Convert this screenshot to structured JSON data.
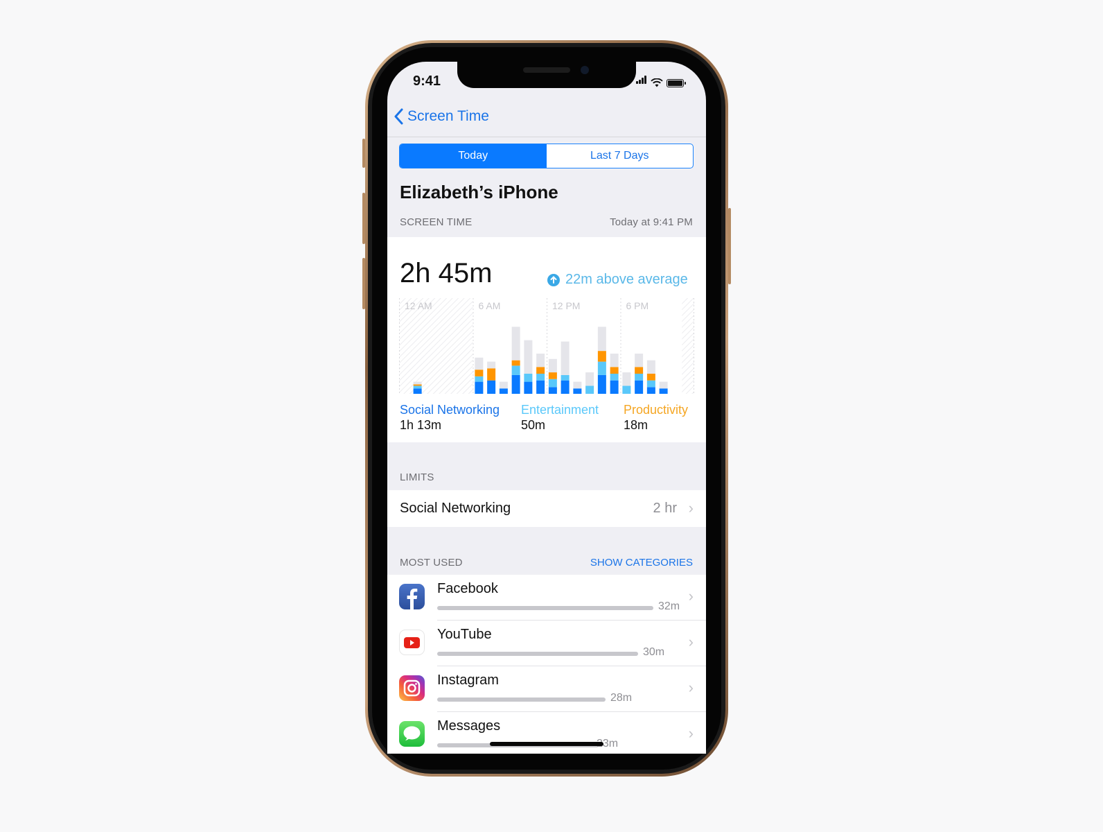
{
  "status_bar": {
    "time": "9:41",
    "icons": [
      "signal-icon",
      "wifi-icon",
      "battery-icon"
    ]
  },
  "nav": {
    "back_label": "Screen Time",
    "back_icon": "chevron-left-icon"
  },
  "segmented": {
    "options": [
      "Today",
      "Last 7 Days"
    ],
    "selected": "Today"
  },
  "device_title": "Elizabeth’s iPhone",
  "screen_time_section": {
    "header": "SCREEN TIME",
    "timestamp": "Today at 9:41 PM",
    "total": "2h 45m",
    "comparison": "22m above average",
    "comparison_icon": "arrow-up-circle-icon"
  },
  "colors": {
    "social": "#0a7aff",
    "entertainment": "#5ac8fa",
    "productivity": "#ff9500",
    "other": "#e5e5ea",
    "accent": "#1a74e8"
  },
  "chart_data": {
    "type": "bar",
    "stacked": true,
    "title": "",
    "xlabel": "",
    "ylabel": "",
    "tick_labels": [
      "12 AM",
      "6 AM",
      "12 PM",
      "6 PM"
    ],
    "categories": [
      "0",
      "1",
      "2",
      "3",
      "4",
      "5",
      "6",
      "7",
      "8",
      "9",
      "10",
      "11",
      "12",
      "13",
      "14",
      "15",
      "16",
      "17",
      "18",
      "19",
      "20",
      "21",
      "22",
      "23"
    ],
    "series": [
      {
        "name": "Social Networking",
        "values": [
          0,
          4,
          0,
          0,
          0,
          0,
          9,
          10,
          4,
          14,
          9,
          10,
          5,
          10,
          4,
          0,
          14,
          10,
          0,
          10,
          5,
          4,
          0,
          0
        ]
      },
      {
        "name": "Entertainment",
        "values": [
          0,
          2,
          0,
          0,
          0,
          0,
          4,
          0,
          0,
          7,
          6,
          5,
          6,
          4,
          0,
          6,
          10,
          5,
          6,
          5,
          5,
          0,
          0,
          0
        ]
      },
      {
        "name": "Productivity",
        "values": [
          0,
          1,
          0,
          0,
          0,
          0,
          5,
          9,
          0,
          4,
          0,
          5,
          5,
          0,
          0,
          0,
          8,
          5,
          0,
          5,
          5,
          0,
          0,
          0
        ]
      },
      {
        "name": "Other",
        "values": [
          0,
          2,
          0,
          0,
          0,
          0,
          9,
          5,
          5,
          25,
          25,
          10,
          10,
          25,
          5,
          10,
          18,
          10,
          10,
          10,
          10,
          5,
          0,
          0
        ]
      }
    ],
    "ylim": [
      0,
      60
    ],
    "inactive_hours_hatched": [
      [
        0,
        5
      ],
      [
        23,
        23
      ]
    ],
    "legend": [
      {
        "name": "Social Networking",
        "value": "1h 13m"
      },
      {
        "name": "Entertainment",
        "value": "50m"
      },
      {
        "name": "Productivity",
        "value": "18m"
      }
    ]
  },
  "limits": {
    "header": "LIMITS",
    "items": [
      {
        "label": "Social Networking",
        "value": "2 hr"
      }
    ]
  },
  "most_used": {
    "header": "MOST USED",
    "action": "SHOW CATEGORIES",
    "apps": [
      {
        "name": "Facebook",
        "time": "32m",
        "minutes": 32,
        "icon": "facebook-icon"
      },
      {
        "name": "YouTube",
        "time": "30m",
        "minutes": 30,
        "icon": "youtube-icon"
      },
      {
        "name": "Instagram",
        "time": "28m",
        "minutes": 28,
        "icon": "instagram-icon"
      },
      {
        "name": "Messages",
        "time": "23m",
        "minutes": 23,
        "icon": "messages-icon"
      }
    ]
  }
}
